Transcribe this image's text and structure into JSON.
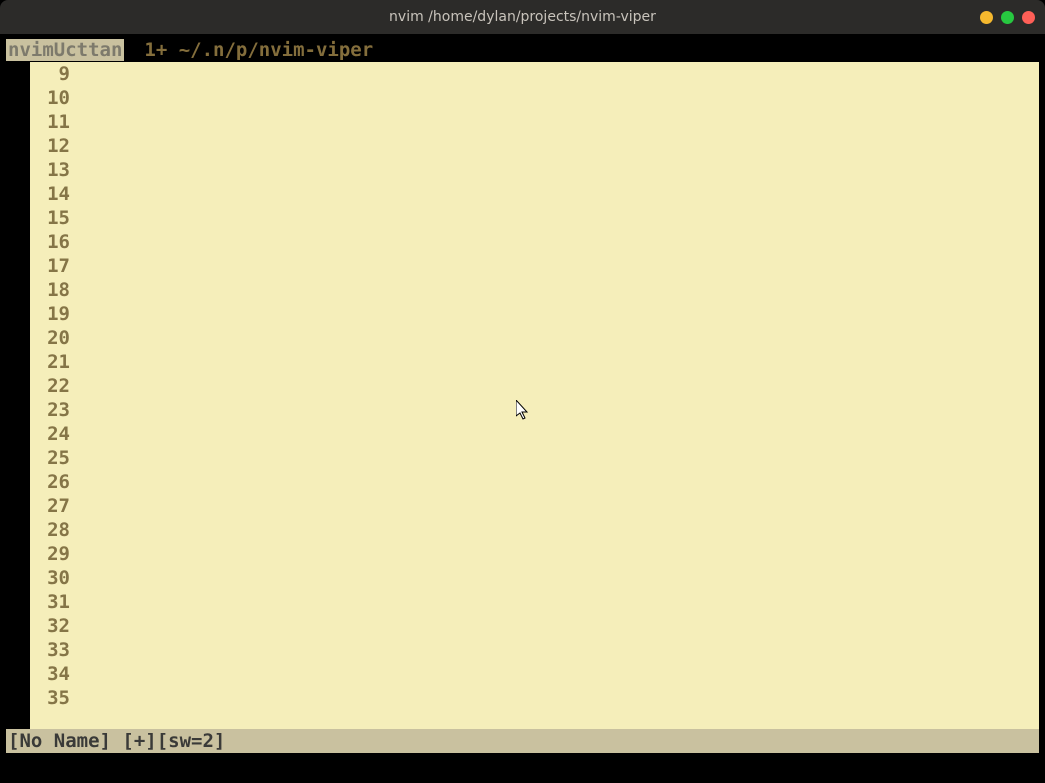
{
  "window": {
    "title": "nvim /home/dylan/projects/nvim-viper"
  },
  "tabline": {
    "group": "nvimUcttan",
    "info": "1+ ~/.n/p/nvim-viper"
  },
  "editor": {
    "line_start": 9,
    "line_end": 35
  },
  "statusline": {
    "text": "[No Name] [+][sw=2]"
  }
}
